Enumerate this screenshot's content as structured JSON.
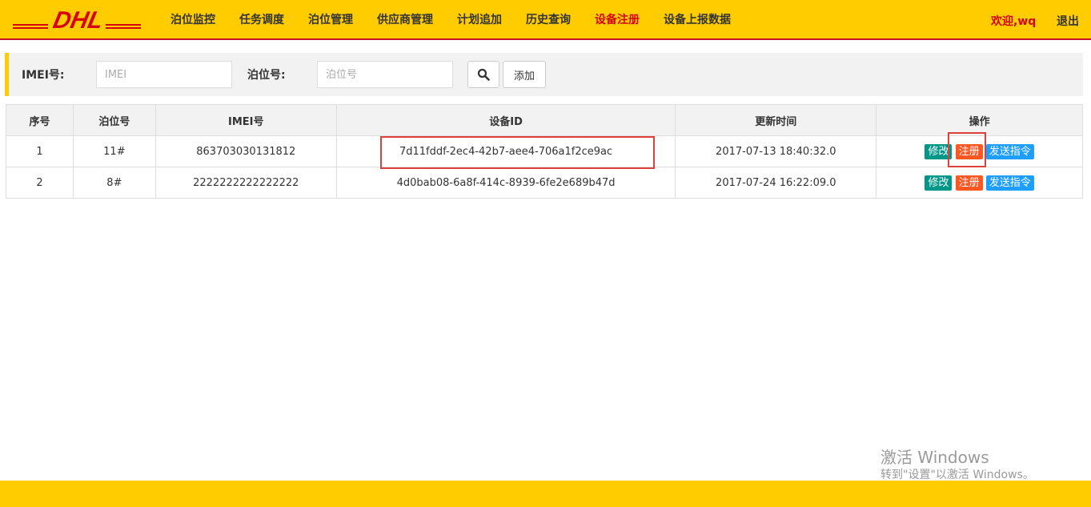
{
  "header": {
    "logo_text": "DHL",
    "nav": [
      {
        "label": "泊位监控",
        "active": false
      },
      {
        "label": "任务调度",
        "active": false
      },
      {
        "label": "泊位管理",
        "active": false
      },
      {
        "label": "供应商管理",
        "active": false
      },
      {
        "label": "计划追加",
        "active": false
      },
      {
        "label": "历史查询",
        "active": false
      },
      {
        "label": "设备注册",
        "active": true
      },
      {
        "label": "设备上报数据",
        "active": false
      }
    ],
    "welcome": "欢迎,wq",
    "logout": "退出"
  },
  "search": {
    "imei_label": "IMEI号:",
    "imei_placeholder": "IMEI",
    "imei_value": "",
    "berth_label": "泊位号:",
    "berth_placeholder": "泊位号",
    "berth_value": "",
    "add_label": "添加"
  },
  "table": {
    "columns": [
      "序号",
      "泊位号",
      "IMEI号",
      "设备ID",
      "更新时间",
      "操作"
    ],
    "rows": [
      {
        "index": "1",
        "berth": "11#",
        "imei": "863703030131812",
        "device_id": "7d11fddf-2ec4-42b7-aee4-706a1f2ce9ac",
        "updated": "2017-07-13 18:40:32.0"
      },
      {
        "index": "2",
        "berth": "8#",
        "imei": "2222222222222222",
        "device_id": "4d0bab08-6a8f-414c-8939-6fe2e689b47d",
        "updated": "2017-07-24 16:22:09.0"
      }
    ],
    "actions": {
      "edit": "修改",
      "register": "注册",
      "send": "发送指令"
    }
  },
  "watermark": {
    "line1": "激活 Windows",
    "line2": "转到\"设置\"以激活 Windows。"
  },
  "colors": {
    "brand_yellow": "#ffcc00",
    "brand_red": "#d40511",
    "edit_green": "#009688",
    "register_orange": "#ff5722",
    "send_blue": "#1e9fff"
  }
}
